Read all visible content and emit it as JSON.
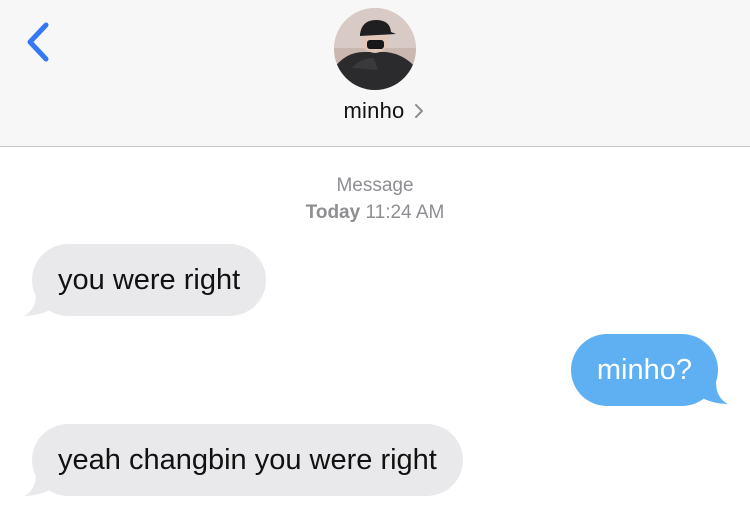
{
  "header": {
    "contact_name": "minho",
    "back_icon": "chevron-left-icon",
    "contact_chevron_icon": "chevron-right-icon",
    "avatar_icon": "contact-avatar"
  },
  "conversation": {
    "service_label": "Message",
    "date_label": "Today",
    "time_label": "11:24 AM",
    "messages": [
      {
        "direction": "incoming",
        "text": "you were right"
      },
      {
        "direction": "outgoing",
        "text": "minho?"
      },
      {
        "direction": "incoming",
        "text": "yeah changbin you were right"
      }
    ]
  },
  "colors": {
    "incoming_bubble": "#e9e9eb",
    "outgoing_bubble": "#5fb0f3",
    "accent": "#3478f6",
    "header_bg": "#f7f7f7",
    "meta_text": "#8e8e93"
  }
}
